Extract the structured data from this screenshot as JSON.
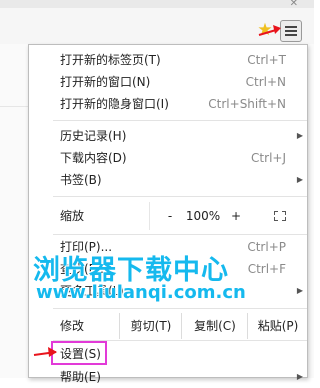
{
  "menu": {
    "new_tab": {
      "label": "打开新的标签页(T)",
      "shortcut": "Ctrl+T"
    },
    "new_window": {
      "label": "打开新的窗口(N)",
      "shortcut": "Ctrl+N"
    },
    "incognito": {
      "label": "打开新的隐身窗口(I)",
      "shortcut": "Ctrl+Shift+N"
    },
    "history": {
      "label": "历史记录(H)"
    },
    "downloads": {
      "label": "下载内容(D)",
      "shortcut": "Ctrl+J"
    },
    "bookmarks": {
      "label": "书签(B)"
    },
    "zoom": {
      "label": "缩放",
      "minus": "-",
      "value": "100%",
      "plus": "+"
    },
    "print": {
      "label": "打印(P)...",
      "shortcut": "Ctrl+P"
    },
    "find": {
      "label": "查找(F)...",
      "shortcut": "Ctrl+F"
    },
    "more_tools": {
      "label": "更多工具(L)"
    },
    "edit": {
      "label": "修改",
      "cut": "剪切(T)",
      "copy": "复制(C)",
      "paste": "粘贴(P)"
    },
    "settings": {
      "label": "设置(S)"
    },
    "help": {
      "label": "帮助(E)"
    }
  },
  "watermark": {
    "title": "浏览器下载中心",
    "url": "www.liulanqi.com.cn"
  },
  "icons": {
    "bookmark_star": "star-icon",
    "menu": "hamburger-menu-icon"
  },
  "colors": {
    "highlight_border": "#e23ad8",
    "arrow": "#e8141c",
    "watermark": "#15b9ee"
  }
}
